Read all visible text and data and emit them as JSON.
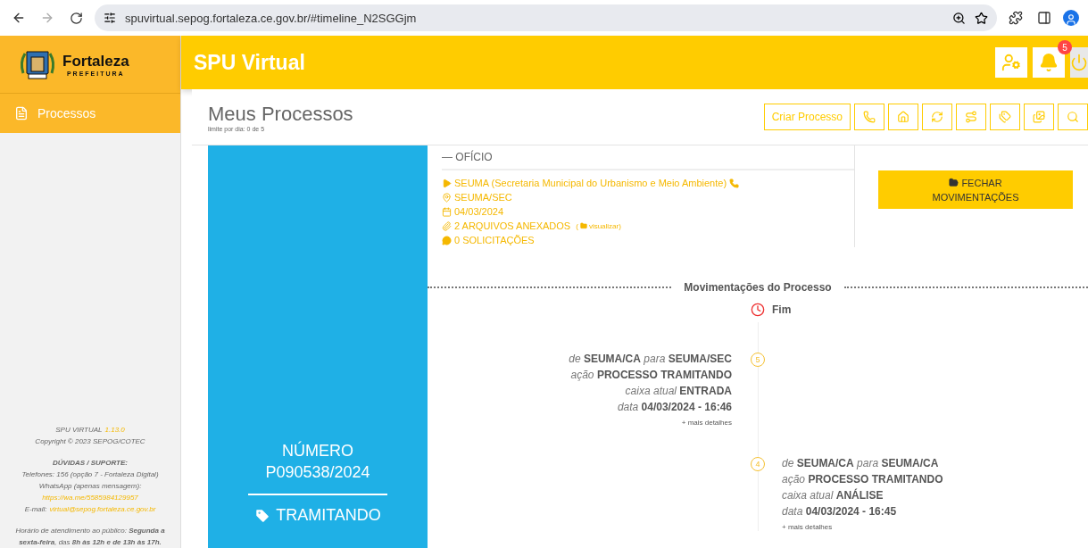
{
  "browser": {
    "url": "spuvirtual.sepog.fortaleza.ce.gov.br/#timeline_N2SGGjm"
  },
  "sidebar": {
    "logo": {
      "name": "Fortaleza",
      "subtitle": "PREFEITURA"
    },
    "items": [
      {
        "label": "Processos",
        "selected": true
      }
    ],
    "footer": {
      "app": "SPU VIRTUAL",
      "version": "1.13.0",
      "copyright": "Copyright © 2023 SEPOG/COTEC",
      "support_title": "DÚVIDAS / SUPORTE:",
      "phones": "Telefones: 156 (opção 7 - Fortaleza Digital)",
      "whatsapp_label": "WhatsApp (apenas mensagem):",
      "whatsapp_link": "https://wa.me/5585984129957",
      "email_label": "E-mail:",
      "email_link": "virtual@sepog.fortaleza.ce.gov.br",
      "hours": "Horário de atendimento ao público: **Segunda a sexta-feira**, das **8h às 12h e de 13h às 17h.**"
    }
  },
  "header": {
    "title": "SPU Virtual",
    "notifications": "5"
  },
  "page": {
    "title": "Meus Processos",
    "subtitle": "limite por dia: 0 de 5",
    "create_button": "Criar Processo"
  },
  "process": {
    "number_label": "NÚMERO",
    "number": "P090538/2024",
    "status": "TRAMITANDO",
    "type": "— OFÍCIO",
    "details": [
      {
        "kind": "destination",
        "text": "SEUMA (Secretaria Municipal do Urbanismo e Meio Ambiente)"
      },
      {
        "kind": "location",
        "text": "SEUMA/SEC"
      },
      {
        "kind": "date",
        "text": "04/03/2024"
      },
      {
        "kind": "attachments",
        "text": "2 ARQUIVOS ANEXADOS",
        "link": {
          "open": "(",
          "label": "visualizar",
          "close": ")"
        }
      },
      {
        "kind": "requests",
        "text": "0 SOLICITAÇÕES"
      }
    ],
    "close_button": "FECHAR MOVIMENTAÇÕES"
  },
  "timeline": {
    "title": "Movimentações do Processo",
    "end_label": "Fim",
    "entries": [
      {
        "number": "5",
        "lines": [
          "*de* **SEUMA/CA** *para* **SEUMA/SEC**",
          "*ação* **PROCESSO TRAMITANDO**",
          "*caixa atual* **ENTRADA**",
          "*data* **04/03/2024 - 16:46**"
        ],
        "more": "+ mais detalhes"
      },
      {
        "number": "4",
        "lines": [
          "*de* **SEUMA/CA** *para* **SEUMA/CA**",
          "*ação* **PROCESSO TRAMITANDO**",
          "*caixa atual* **ANÁLISE**",
          "*data* **04/03/2024 - 16:45**"
        ],
        "more": "+ mais detalhes"
      }
    ]
  }
}
